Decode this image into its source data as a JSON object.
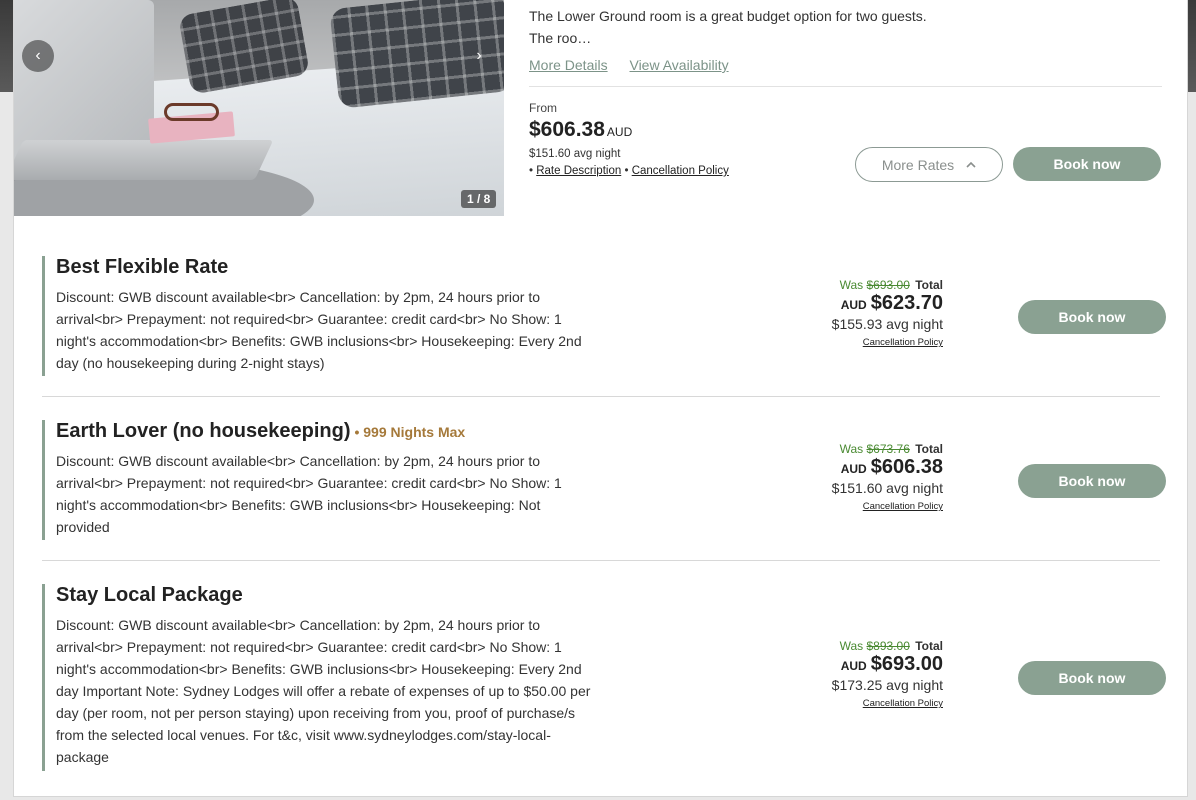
{
  "room": {
    "description": "The Lower Ground room is a great budget option for two guests. The roo…",
    "more_details": "More Details",
    "view_availability": "View Availability",
    "from_label": "From",
    "from_price": "$606.38",
    "from_currency": "AUD",
    "avg_night": "$151.60 avg night",
    "bullet": "•",
    "rate_description": "Rate Description",
    "cancellation_policy": "Cancellation Policy",
    "more_rates": "More Rates",
    "book_now": "Book now",
    "gallery_counter": "1 / 8"
  },
  "rates": [
    {
      "title": "Best Flexible Rate",
      "max": "",
      "description": "Discount: GWB discount available<br> Cancellation: by 2pm, 24 hours prior to arrival<br> Prepayment: not required<br> Guarantee: credit card<br> No Show: 1 night's accommodation<br> Benefits: GWB inclusions<br> Housekeeping: Every 2nd day (no housekeeping during 2-night stays)",
      "was_label": "Was",
      "was_price": "$693.00",
      "total_label": "Total",
      "currency": "AUD",
      "price": "$623.70",
      "avg": "$155.93 avg night",
      "cancellation": "Cancellation Policy",
      "book": "Book now"
    },
    {
      "title": "Earth Lover (no housekeeping)",
      "max": "• 999 Nights Max",
      "description": "Discount: GWB discount available<br> Cancellation: by 2pm, 24 hours prior to arrival<br> Prepayment: not required<br> Guarantee: credit card<br> No Show: 1 night's accommodation<br> Benefits: GWB inclusions<br> Housekeeping: Not provided",
      "was_label": "Was",
      "was_price": "$673.76",
      "total_label": "Total",
      "currency": "AUD",
      "price": "$606.38",
      "avg": "$151.60 avg night",
      "cancellation": "Cancellation Policy",
      "book": "Book now"
    },
    {
      "title": "Stay Local Package",
      "max": "",
      "description": "Discount: GWB discount available<br> Cancellation: by 2pm, 24 hours prior to arrival<br> Prepayment: not required<br> Guarantee: credit card<br> No Show: 1 night's accommodation<br> Benefits: GWB inclusions<br> Housekeeping: Every 2nd day Important Note: Sydney Lodges will offer a rebate of expenses of up to $50.00 per day (per room, not per person staying) upon receiving from you, proof of purchase/s from the selected local venues. For t&c, visit www.sydneylodges.com/stay-local-package",
      "was_label": "Was",
      "was_price": "$893.00",
      "total_label": "Total",
      "currency": "AUD",
      "price": "$693.00",
      "avg": "$173.25 avg night",
      "cancellation": "Cancellation Policy",
      "book": "Book now"
    }
  ],
  "icons": {
    "prev": "‹",
    "next": "›",
    "chevron_up": "^",
    "apple": ""
  },
  "colors": {
    "accent": "#8aa192",
    "link": "#7c9388",
    "was": "#4a8a32",
    "max": "#a5793a"
  }
}
